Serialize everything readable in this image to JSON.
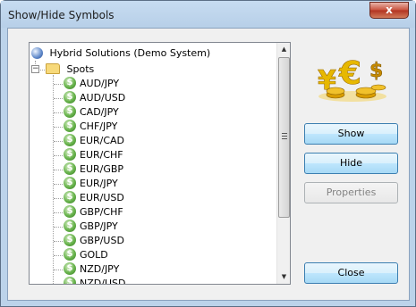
{
  "window": {
    "title": "Show/Hide Symbols",
    "close_glyph": "x"
  },
  "tree": {
    "root_label": "Hybrid Solutions (Demo System)",
    "root_icon": "globe-icon",
    "group_label": "Spots",
    "group_expander": "−",
    "group_icon": "folder-icon",
    "symbol_icon": "dollar-coin-icon",
    "symbol_glyph": "$",
    "symbols": [
      "AUD/JPY",
      "AUD/USD",
      "CAD/JPY",
      "CHF/JPY",
      "EUR/CAD",
      "EUR/CHF",
      "EUR/GBP",
      "EUR/JPY",
      "EUR/USD",
      "GBP/CHF",
      "GBP/JPY",
      "GBP/USD",
      "GOLD",
      "NZD/JPY",
      "NZD/USD"
    ]
  },
  "scrollbar": {
    "up_glyph": "▲",
    "down_glyph": "▼"
  },
  "buttons": {
    "show": "Show",
    "hide": "Hide",
    "properties": "Properties",
    "close": "Close"
  },
  "logo": {
    "symbols": [
      "¥",
      "€",
      "$"
    ],
    "colors": [
      "#e7b800",
      "#c68a00"
    ]
  }
}
